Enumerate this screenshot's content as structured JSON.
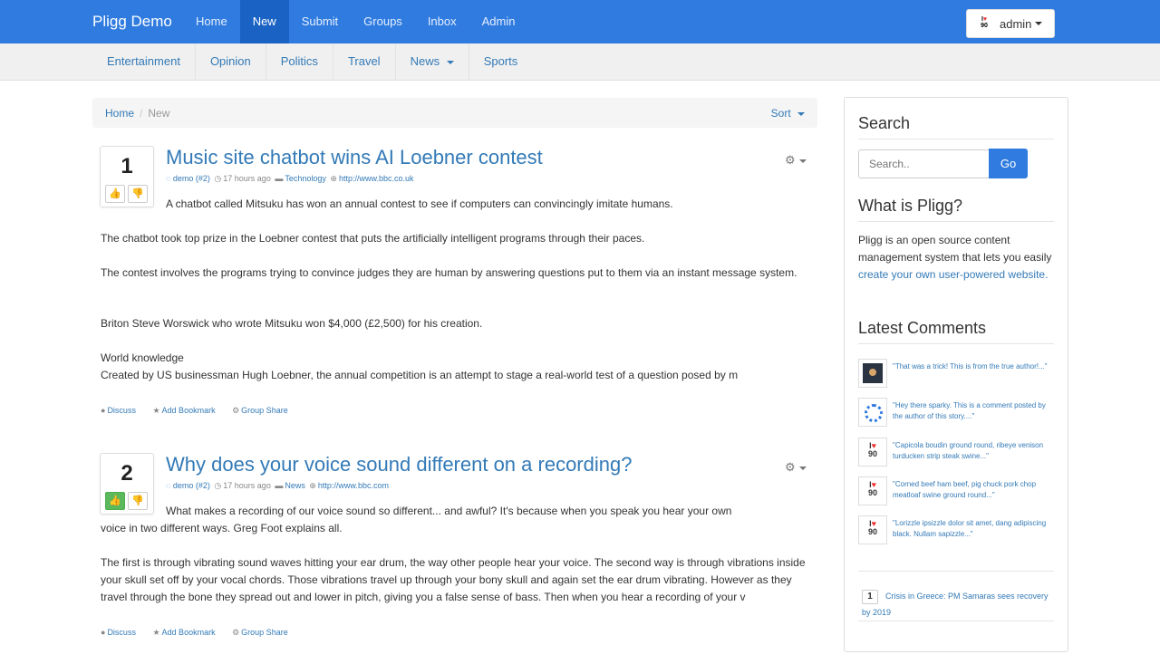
{
  "brand": "Pligg Demo",
  "top_nav": [
    {
      "label": "Home",
      "active": false
    },
    {
      "label": "New",
      "active": true
    },
    {
      "label": "Submit",
      "active": false
    },
    {
      "label": "Groups",
      "active": false
    },
    {
      "label": "Inbox",
      "active": false
    },
    {
      "label": "Admin",
      "active": false
    }
  ],
  "user_menu": {
    "name": "admin"
  },
  "categories": [
    "Entertainment",
    "Opinion",
    "Politics",
    "Travel",
    "News",
    "Sports"
  ],
  "breadcrumb": {
    "home": "Home",
    "separator": "/",
    "current": "New",
    "sort_label": "Sort"
  },
  "stories": [
    {
      "votes": "1",
      "title": "Music site chatbot wins AI Loebner contest",
      "author": "demo (#2)",
      "time": "17 hours ago",
      "category": "Technology",
      "url": "http://www.bbc.co.uk",
      "lead": "A chatbot called Mitsuku has won an annual contest to see if computers can convincingly imitate humans.",
      "paragraphs": [
        "The chatbot took top prize in the Loebner contest that puts the artificially intelligent programs through their paces.",
        "The contest involves the programs trying to convince judges they are human by answering questions put to them via an instant message system.",
        "Briton Steve Worswick who wrote Mitsuku won $4,000 (£2,500) for his creation.",
        "World knowledge\nCreated by US businessman Hugh Loebner, the annual competition is an attempt to stage a real-world test of a question posed by m"
      ],
      "actions": {
        "discuss": "Discuss",
        "bookmark": "Add Bookmark",
        "share": "Group Share"
      }
    },
    {
      "votes": "2",
      "title": "Why does your voice sound different on a recording?",
      "author": "demo (#2)",
      "time": "17 hours ago",
      "category": "News",
      "url": "http://www.bbc.com",
      "lead": "What makes a recording of our voice sound so different... and awful? It's because when you speak you hear your own",
      "lead_cont": "voice in two different ways. Greg Foot explains all.",
      "paragraphs": [
        "The first is through vibrating sound waves hitting your ear drum, the way other people hear your voice. The second way is through vibrations inside your skull set off by your vocal chords. Those vibrations travel up through your bony skull and again set the ear drum vibrating. However as they travel through the bone they spread out and lower in pitch, giving you a false sense of bass. Then when you hear a recording of your v"
      ],
      "actions": {
        "discuss": "Discuss",
        "bookmark": "Add Bookmark",
        "share": "Group Share"
      }
    }
  ],
  "sidebar": {
    "search": {
      "heading": "Search",
      "placeholder": "Search..",
      "button": "Go"
    },
    "about": {
      "heading": "What is Pligg?",
      "text": "Pligg is an open source content management system that lets you easily ",
      "link": "create your own user-powered website."
    },
    "latest_comments": {
      "heading": "Latest Comments",
      "items": [
        {
          "avatar": "photo",
          "text": "\"That was a trick! This is from the true author!...\""
        },
        {
          "avatar": "default",
          "text": "\"Hey there sparky. This is a comment posted by the author of this story....\""
        },
        {
          "avatar": "i-love-90",
          "text": "\"Capicola boudin ground round, ribeye venison turducken strip steak swine...\""
        },
        {
          "avatar": "i-love-90",
          "text": "\"Corned beef ham beef, pig chuck pork chop meatloaf swine ground round...\""
        },
        {
          "avatar": "i-love-90",
          "text": "\"Lorizzle ipsizzle dolor sit amet, dang adipiscing black. Nullam sapizzle...\""
        }
      ]
    },
    "top_story": {
      "count": "1",
      "title": "Crisis in Greece: PM Samaras sees recovery by 2019"
    }
  },
  "colors": {
    "primary": "#2f7be0",
    "active_nav": "#1a63c4",
    "link": "#337ab7",
    "vote_up": "#5cb85c"
  }
}
